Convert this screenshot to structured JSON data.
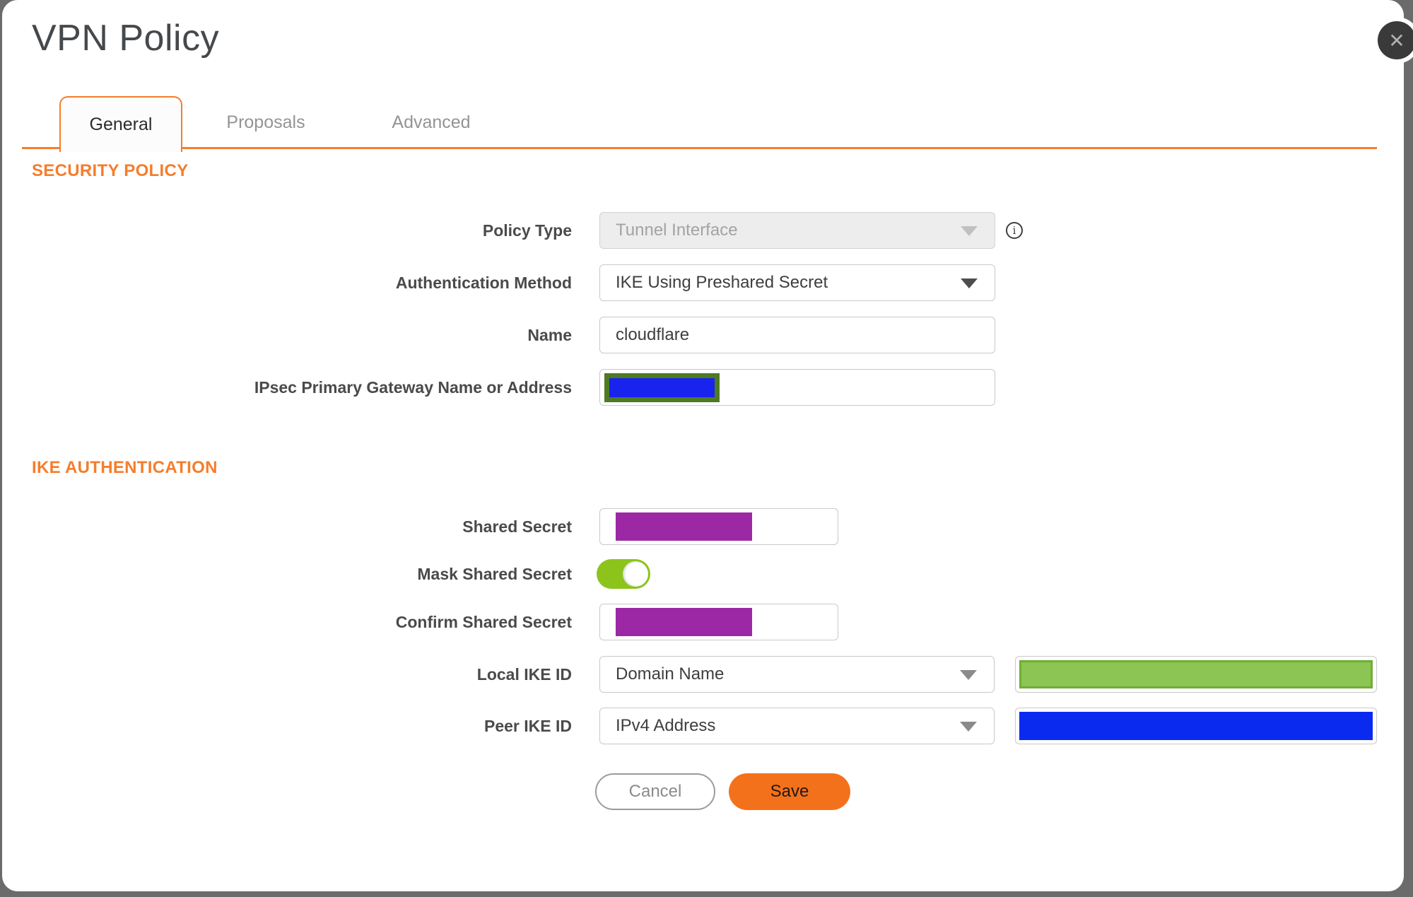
{
  "dialog": {
    "title": "VPN Policy",
    "close_icon": "✕"
  },
  "tabs": [
    {
      "label": "General",
      "active": true
    },
    {
      "label": "Proposals",
      "active": false
    },
    {
      "label": "Advanced",
      "active": false
    }
  ],
  "sections": {
    "security_policy": "SECURITY POLICY",
    "ike_authentication": "IKE AUTHENTICATION"
  },
  "fields": {
    "policy_type": {
      "label": "Policy Type",
      "value": "Tunnel Interface",
      "disabled": true
    },
    "authentication_method": {
      "label": "Authentication Method",
      "value": "IKE Using Preshared Secret"
    },
    "name": {
      "label": "Name",
      "value": "cloudflare"
    },
    "gateway": {
      "label": "IPsec Primary Gateway Name or Address",
      "value": "",
      "redacted": true
    },
    "shared_secret": {
      "label": "Shared Secret",
      "value": "",
      "redacted": true
    },
    "mask_shared_secret": {
      "label": "Mask Shared Secret",
      "toggle_on": true
    },
    "confirm_shared_secret": {
      "label": "Confirm Shared Secret",
      "value": "",
      "redacted": true
    },
    "local_ike_id": {
      "label": "Local IKE ID",
      "value": "Domain Name",
      "id_value_redacted": true
    },
    "peer_ike_id": {
      "label": "Peer IKE ID",
      "value": "IPv4 Address",
      "id_value_redacted": true
    }
  },
  "buttons": {
    "cancel": "Cancel",
    "save": "Save"
  },
  "info_icon": "i",
  "colors": {
    "accent_orange": "#f57d2c",
    "save_orange": "#f4711c",
    "toggle_green": "#8cc41c",
    "redaction_purple": "#9c28a5",
    "redaction_blue_fill": "#1823ee",
    "redaction_olive_border": "#4e7a22",
    "local_id_green": "#8cc553",
    "peer_id_blue": "#0b2af0",
    "backdrop_gray": "#6b6b6b"
  }
}
